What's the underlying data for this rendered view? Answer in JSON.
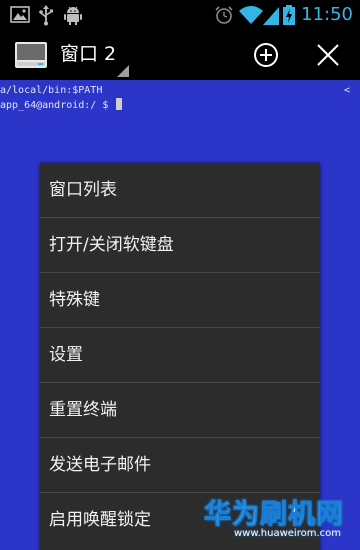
{
  "status_bar": {
    "time": "11:50",
    "icons": [
      "image-notification-icon",
      "usb-icon",
      "android-debug-icon",
      "alarm-icon",
      "wifi-icon",
      "battery-charging-icon",
      "signal-icon"
    ],
    "accent": "#33b5e5"
  },
  "action_bar": {
    "window_title": "窗口 2",
    "icons": [
      "terminal-app-icon",
      "new-window-icon",
      "close-window-icon"
    ]
  },
  "terminal": {
    "lines": [
      "a/local/bin:$PATH",
      "app_64@android:/ $ "
    ],
    "scroll_indicator": "<",
    "background": "#2b35c8"
  },
  "menu": {
    "items": [
      {
        "label": "窗口列表"
      },
      {
        "label": "打开/关闭软键盘"
      },
      {
        "label": "特殊键"
      },
      {
        "label": "设置"
      },
      {
        "label": "重置终端"
      },
      {
        "label": "发送电子邮件"
      },
      {
        "label": "启用唤醒锁定"
      }
    ]
  },
  "watermark": {
    "text": "华为刷机网",
    "url": "www.huaweirom.com"
  }
}
